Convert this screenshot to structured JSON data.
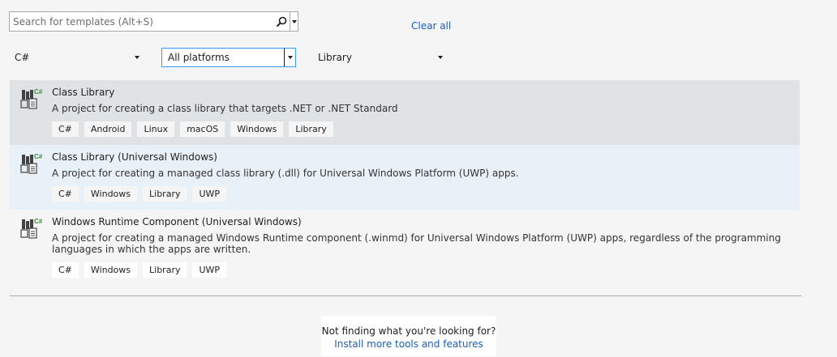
{
  "search": {
    "placeholder": "Search for templates (Alt+S)",
    "value": ""
  },
  "clear_all": "Clear all",
  "filters": {
    "language": "C#",
    "platform": "All platforms",
    "project_type": "Library"
  },
  "templates": [
    {
      "title": "Class Library",
      "description": "A project for creating a class library that targets .NET or .NET Standard",
      "tags": [
        "C#",
        "Android",
        "Linux",
        "macOS",
        "Windows",
        "Library"
      ],
      "icon": "csharp-class-library-icon"
    },
    {
      "title": "Class Library (Universal Windows)",
      "description": "A project for creating a managed class library (.dll) for Universal Windows Platform (UWP) apps.",
      "tags": [
        "C#",
        "Windows",
        "Library",
        "UWP"
      ],
      "icon": "csharp-class-library-icon"
    },
    {
      "title": "Windows Runtime Component (Universal Windows)",
      "description": "A project for creating a managed Windows Runtime component (.winmd) for Universal Windows Platform (UWP) apps, regardless of the programming languages in which the apps are written.",
      "tags": [
        "C#",
        "Windows",
        "Library",
        "UWP"
      ],
      "icon": "csharp-class-library-icon"
    }
  ],
  "not_finding": {
    "text": "Not finding what you're looking for?",
    "link": "Install more tools and features"
  },
  "colors": {
    "accent": "#1a5fb4",
    "selected_bg": "#e0e3e6",
    "hover_bg": "#e8f0f8",
    "focus_border": "#3399ff"
  }
}
